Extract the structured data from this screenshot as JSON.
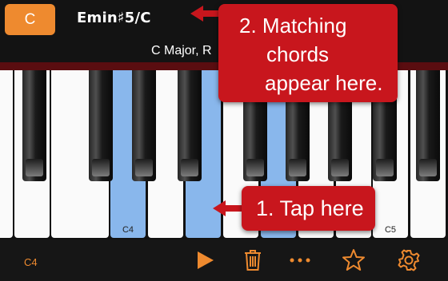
{
  "top": {
    "root_note": "C",
    "chord": "Emin♯5/C",
    "scale": "C Major, R"
  },
  "keyboard": {
    "white_keys": [
      {
        "label": "",
        "highlighted": false
      },
      {
        "label": "",
        "highlighted": false
      },
      {
        "label": "",
        "highlighted": true
      },
      {
        "label": "",
        "highlighted": false
      },
      {
        "label": "C4",
        "highlighted": false
      },
      {
        "label": "",
        "highlighted": false
      },
      {
        "label": "",
        "highlighted": true
      },
      {
        "label": "",
        "highlighted": false
      },
      {
        "label": "",
        "highlighted": false
      },
      {
        "label": "",
        "highlighted": false
      },
      {
        "label": "",
        "highlighted": false
      },
      {
        "label": "C5",
        "highlighted": false
      },
      {
        "label": "",
        "highlighted": false
      }
    ]
  },
  "callouts": {
    "matching": {
      "line1": "2. Matching",
      "line2": "chords",
      "line3": "appear here."
    },
    "tap": {
      "text": "1. Tap here"
    }
  },
  "bottom": {
    "octave": "C4"
  },
  "colors": {
    "accent": "#ee8a2f",
    "highlight": "#89b7ec",
    "callout": "#c8161d"
  }
}
